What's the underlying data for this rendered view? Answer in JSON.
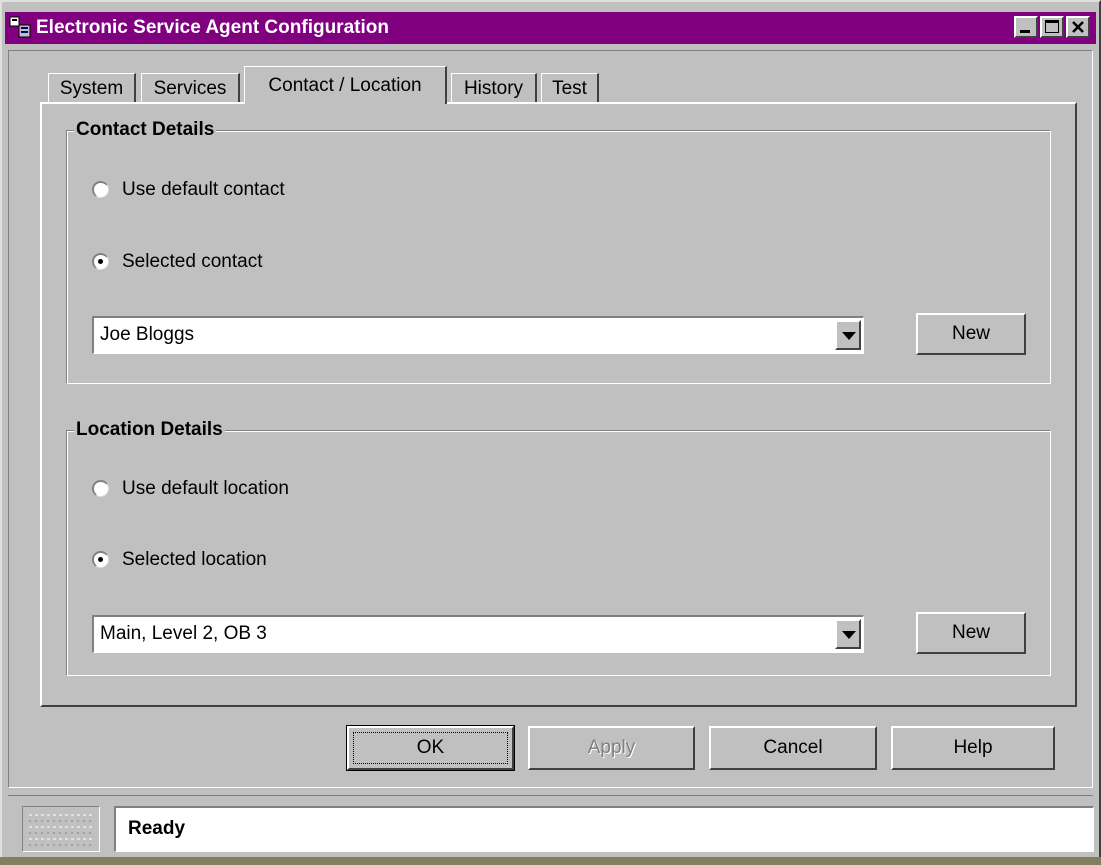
{
  "window": {
    "title": "Electronic Service Agent Configuration",
    "title_bar_color": "#800080",
    "icons": [
      "app-icon",
      "minimize-icon",
      "maximize-icon",
      "close-icon"
    ]
  },
  "tabs": [
    {
      "label": "System",
      "active": false
    },
    {
      "label": "Services",
      "active": false
    },
    {
      "label": "Contact / Location",
      "active": true
    },
    {
      "label": "History",
      "active": false
    },
    {
      "label": "Test",
      "active": false
    }
  ],
  "contact": {
    "group_title": "Contact Details",
    "radio_default_label": "Use default contact",
    "radio_selected_label": "Selected contact",
    "selected_option": "Selected contact",
    "combo_value": "Joe Bloggs",
    "new_label": "New"
  },
  "location": {
    "group_title": "Location Details",
    "radio_default_label": "Use default location",
    "radio_selected_label": "Selected location",
    "selected_option": "Selected location",
    "combo_value": "Main, Level 2, OB 3",
    "new_label": "New"
  },
  "buttons": {
    "ok": "OK",
    "apply": "Apply",
    "apply_enabled": false,
    "cancel": "Cancel",
    "help": "Help"
  },
  "status": {
    "text": "Ready"
  }
}
